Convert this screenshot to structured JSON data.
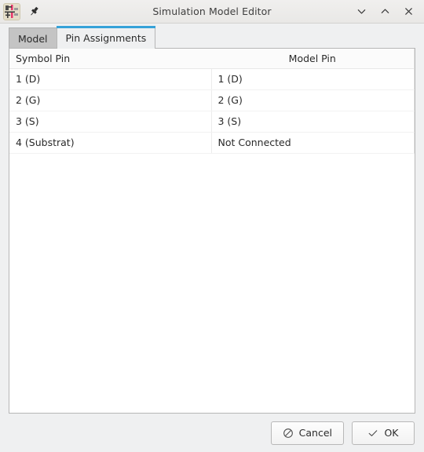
{
  "window": {
    "title": "Simulation Model Editor",
    "app_icon": "kicad-simulation-model-icon",
    "pin_icon": "pushpin-icon",
    "controls": [
      {
        "name": "minimize",
        "icon": "chevron-down-icon",
        "glyph": "∨"
      },
      {
        "name": "maximize",
        "icon": "chevron-up-icon",
        "glyph": "∧"
      },
      {
        "name": "close",
        "icon": "close-x-icon",
        "glyph": "✕"
      }
    ]
  },
  "tabs": [
    {
      "label": "Model",
      "active": false
    },
    {
      "label": "Pin Assignments",
      "active": true
    }
  ],
  "accent_color": "#36a2d8",
  "pin_table": {
    "columns": [
      "Symbol Pin",
      "Model Pin"
    ],
    "rows": [
      {
        "symbol_pin": "1 (D)",
        "model_pin": "1 (D)"
      },
      {
        "symbol_pin": "2 (G)",
        "model_pin": "2 (G)"
      },
      {
        "symbol_pin": "3 (S)",
        "model_pin": "3 (S)"
      },
      {
        "symbol_pin": "4 (Substrat)",
        "model_pin": "Not Connected"
      }
    ]
  },
  "buttons": {
    "cancel": {
      "label": "Cancel",
      "icon": "no-entry-icon"
    },
    "ok": {
      "label": "OK",
      "icon": "check-icon"
    }
  }
}
